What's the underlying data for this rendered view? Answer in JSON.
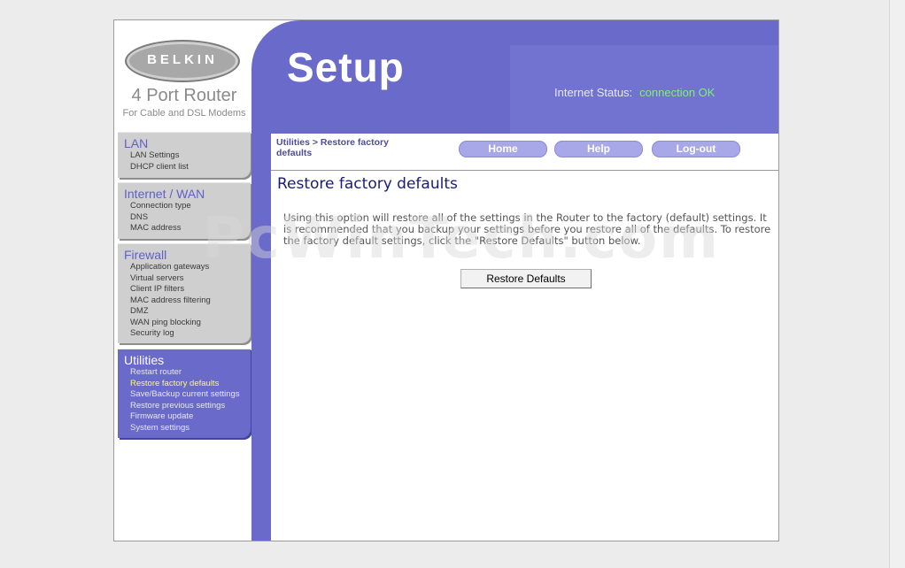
{
  "brand": {
    "logo_text": "BELKIN",
    "product": "4 Port Router",
    "subtitle": "For Cable and DSL Modems"
  },
  "header": {
    "title": "Setup",
    "status_label": "Internet Status:",
    "status_value": "connection OK"
  },
  "nav": {
    "sections": [
      {
        "heading": "LAN",
        "items": [
          "LAN Settings",
          "DHCP client list"
        ]
      },
      {
        "heading": "Internet / WAN",
        "items": [
          "Connection type",
          "DNS",
          "MAC address"
        ]
      },
      {
        "heading": "Firewall",
        "items": [
          "Application gateways",
          "Virtual servers",
          "Client IP filters",
          "MAC address filtering",
          "DMZ",
          "WAN ping blocking",
          "Security log"
        ]
      },
      {
        "heading": "Utilities",
        "items": [
          "Restart router",
          "Restore factory defaults",
          "Save/Backup current settings",
          "Restore previous settings",
          "Firmware update",
          "System settings"
        ]
      }
    ]
  },
  "content": {
    "breadcrumb": "Utilities > Restore factory defaults",
    "buttons": {
      "home": "Home",
      "help": "Help",
      "logout": "Log-out"
    },
    "page_title": "Restore factory defaults",
    "description": "Using this option will restore all of the settings in the Router to the factory (default) settings. It is recommended that you backup your settings before you restore all of the defaults. To restore the factory default settings, click the \"Restore Defaults\" button below.",
    "restore_button": "Restore Defaults"
  },
  "watermark": "PcWinTech.com",
  "colors": {
    "accent_purple": "#6a6acb",
    "nav_gray": "#cfcfcf",
    "status_ok": "#7cf07c",
    "current_item": "#ffff5a",
    "title_blue": "#1a1a7a"
  }
}
